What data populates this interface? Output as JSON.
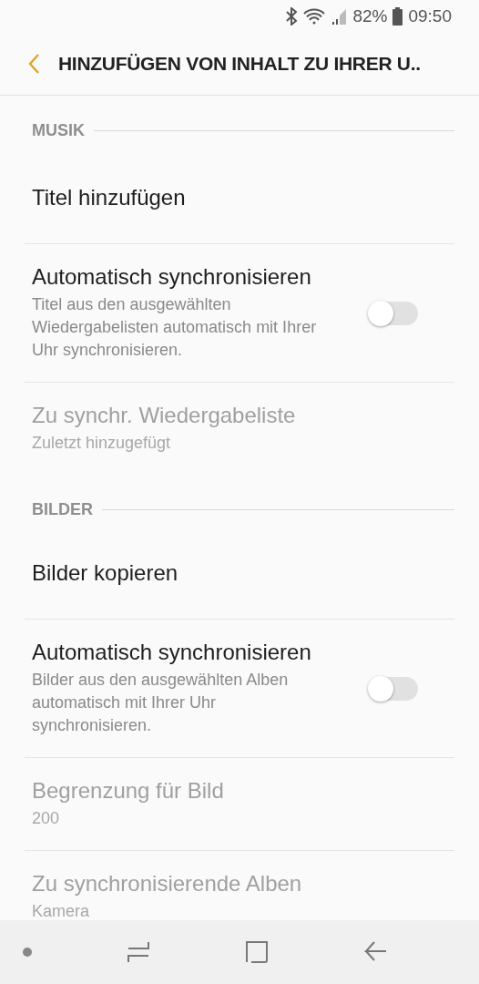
{
  "status_bar": {
    "battery": "82%",
    "time": "09:50"
  },
  "header": {
    "title": "HINZUFÜGEN VON INHALT ZU IHRER U.."
  },
  "sections": [
    {
      "title": "MUSIK",
      "items": [
        {
          "kind": "action",
          "title": "Titel hinzufügen",
          "disabled": false
        },
        {
          "kind": "toggle",
          "title": "Automatisch synchronisieren",
          "subtitle": "Titel aus den ausgewählten Wiedergabelisten automatisch mit Ihrer Uhr synchronisieren.",
          "on": false,
          "disabled": false
        },
        {
          "kind": "info",
          "title": "Zu synchr. Wiedergabeliste",
          "subtitle": "Zuletzt hinzugefügt",
          "disabled": true
        }
      ]
    },
    {
      "title": "BILDER",
      "items": [
        {
          "kind": "action",
          "title": "Bilder kopieren",
          "disabled": false
        },
        {
          "kind": "toggle",
          "title": "Automatisch synchronisieren",
          "subtitle": "Bilder aus den ausgewählten Alben automatisch mit Ihrer Uhr synchronisieren.",
          "on": false,
          "disabled": false
        },
        {
          "kind": "info",
          "title": "Begrenzung für Bild",
          "subtitle": "200",
          "disabled": true
        },
        {
          "kind": "info",
          "title": "Zu synchronisierende Alben",
          "subtitle": "Kamera",
          "disabled": true
        }
      ]
    }
  ]
}
